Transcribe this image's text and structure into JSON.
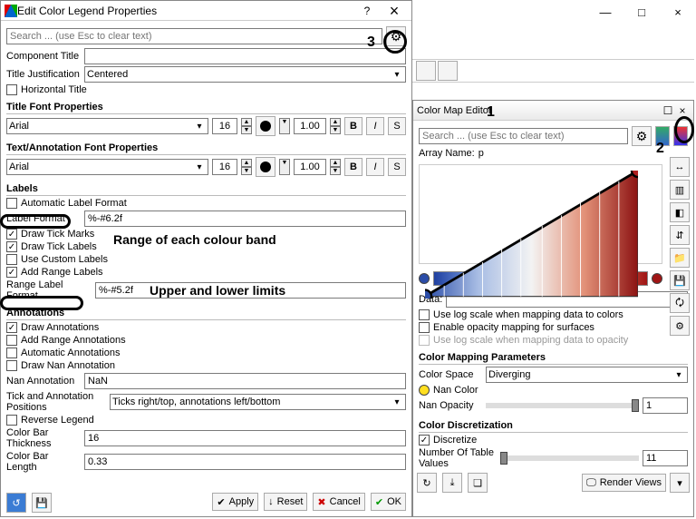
{
  "main_window": {
    "min_icon": "—",
    "max_icon": "□",
    "close_icon": "×"
  },
  "dialog": {
    "title": "Edit Color Legend Properties",
    "help": "?",
    "close": "×",
    "search_placeholder": "Search ... (use Esc to clear text)",
    "component_title_label": "Component Title",
    "component_title_value": "",
    "title_justification_label": "Title Justification",
    "title_justification_value": "Centered",
    "horizontal_title": "Horizontal Title",
    "section_title_font": "Title Font Properties",
    "section_text_font": "Text/Annotation Font Properties",
    "font_family": "Arial",
    "font_size": "16",
    "font_opacity": "1.00",
    "bold": "B",
    "italic": "I",
    "shadow": "S",
    "section_labels": "Labels",
    "automatic_label_format": "Automatic Label Format",
    "label_format_label": "Label Format",
    "label_format_value": "%-#6.2f",
    "draw_tick_marks": "Draw Tick Marks",
    "draw_tick_labels": "Draw Tick Labels",
    "use_custom_labels": "Use Custom Labels",
    "add_range_labels": "Add Range Labels",
    "range_label_format_label": "Range Label Format",
    "range_label_format_value": "%-#5.2f",
    "section_annotations": "Annotations",
    "draw_annotations": "Draw Annotations",
    "add_range_annotations": "Add Range Annotations",
    "automatic_annotations": "Automatic Annotations",
    "draw_nan_annotation": "Draw Nan Annotation",
    "nan_annotation_label": "Nan Annotation",
    "nan_annotation_value": "NaN",
    "tick_pos_label": "Tick and Annotation Positions",
    "tick_pos_value": "Ticks right/top, annotations left/bottom",
    "reverse_legend": "Reverse Legend",
    "color_bar_thickness_label": "Color Bar Thickness",
    "color_bar_thickness_value": "16",
    "color_bar_length_label": "Color Bar Length",
    "color_bar_length_value": "0.33",
    "apply": "Apply",
    "reset": "Reset",
    "cancel": "Cancel",
    "ok": "OK"
  },
  "cme": {
    "title": "Color Map Editor",
    "close": "×",
    "float": "☐",
    "search_placeholder": "Search ... (use Esc to clear text)",
    "array_name_label": "Array Name:",
    "array_name_value": "p",
    "data_label": "Data:",
    "use_log_mapping": "Use log scale when mapping data to colors",
    "enable_opacity_surfaces": "Enable opacity mapping for surfaces",
    "use_log_opacity": "Use log scale when mapping data to opacity",
    "section_mapping": "Color Mapping Parameters",
    "color_space_label": "Color Space",
    "color_space_value": "Diverging",
    "nan_color_label": "Nan Color",
    "nan_opacity_label": "Nan Opacity",
    "nan_opacity_value": "1",
    "section_discretization": "Color Discretization",
    "discretize": "Discretize",
    "num_table_values_label": "Number Of Table Values",
    "num_table_values_value": "11",
    "render_views": "Render Views"
  },
  "annotations": {
    "num1": "1",
    "num2": "2",
    "num3": "3",
    "range_band": "Range of each colour band",
    "limits": "Upper and lower limits"
  }
}
